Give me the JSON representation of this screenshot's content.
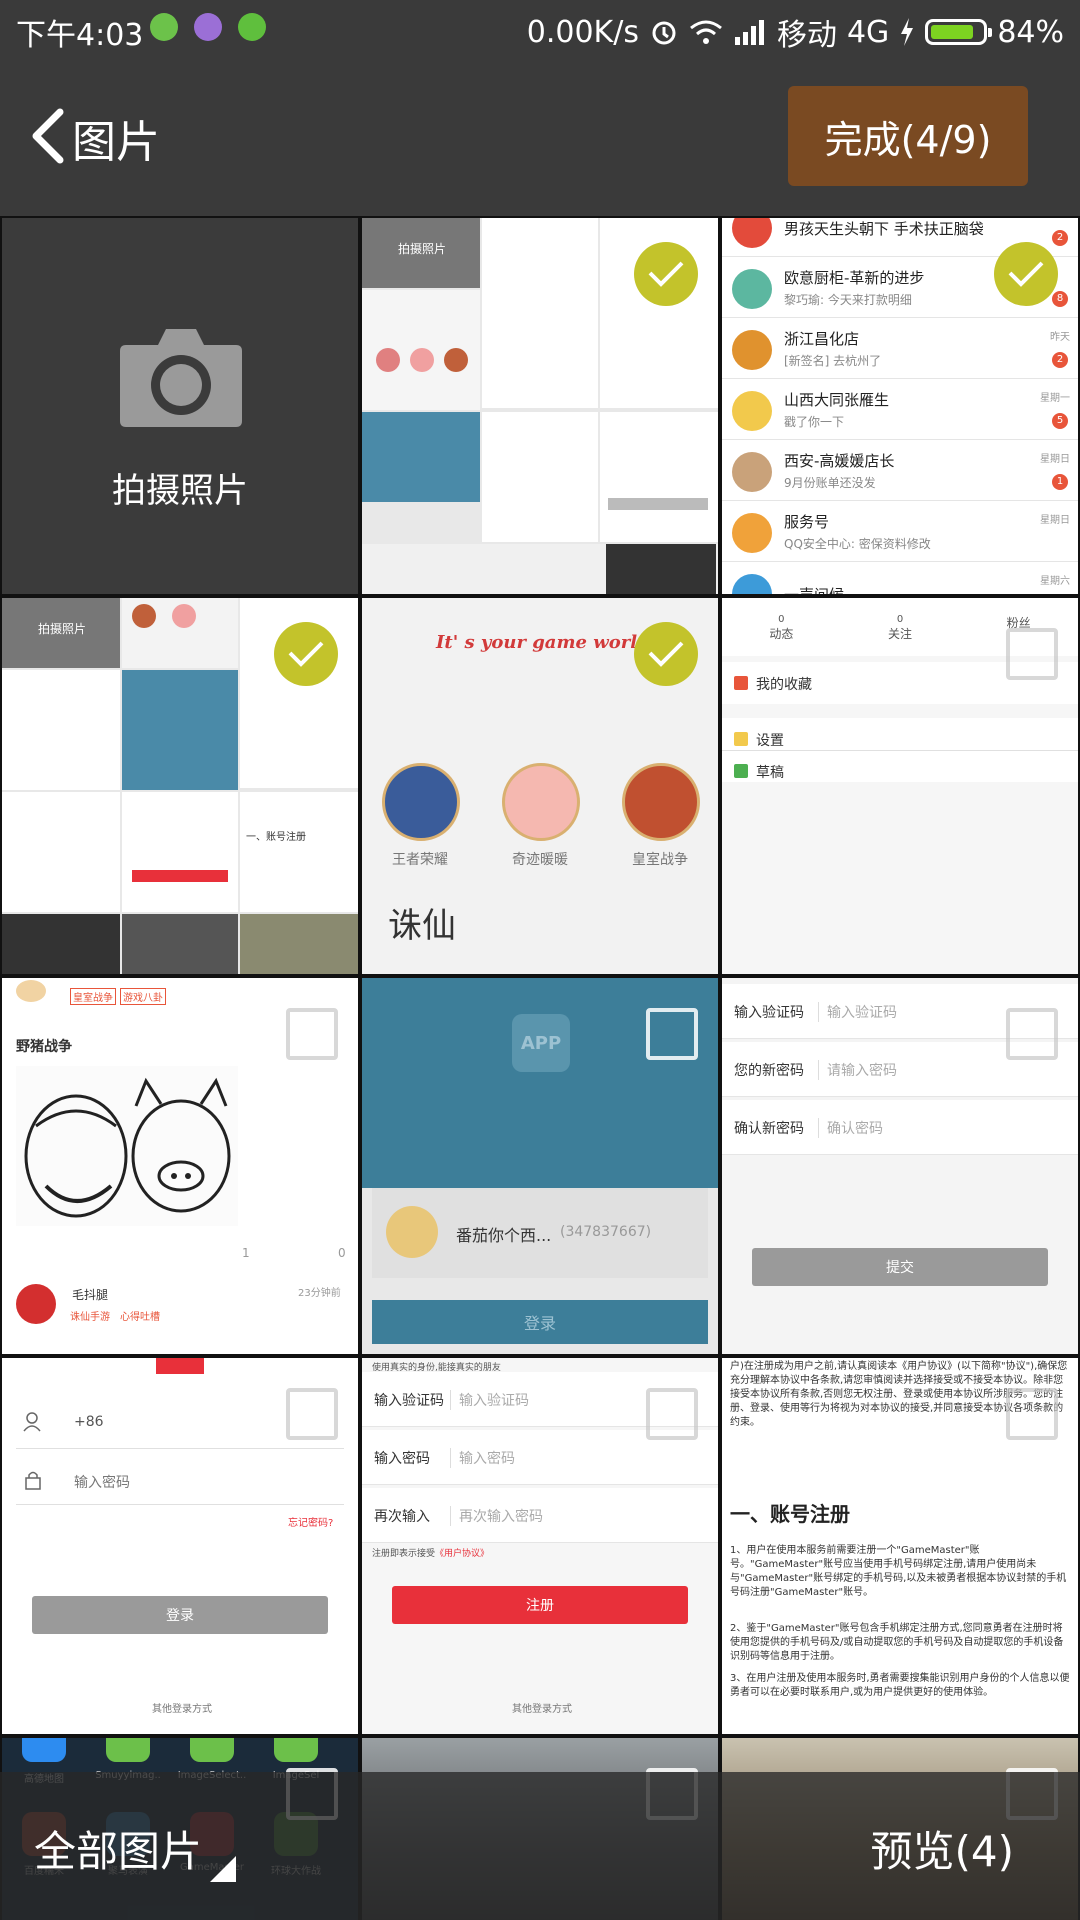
{
  "status_bar": {
    "time": "下午4:03",
    "net_speed": "0.00K/s",
    "carrier": "移动",
    "network": "4G",
    "battery": "84%",
    "battery_level": 0.84
  },
  "header": {
    "title": "图片",
    "done_label": "完成(4/9)"
  },
  "camera_tile": {
    "label": "拍摄照片"
  },
  "tiles": {
    "t1": {
      "caption": "拍摄照片"
    },
    "t2": {
      "rows": [
        {
          "name": "男孩天生头朝下 手术扶正脑袋",
          "time": "",
          "badge": "2"
        },
        {
          "name": "欧意厨柜-革新的进步",
          "sub": "黎巧瑜: 今天来打款明细",
          "time": "",
          "badge": "8"
        },
        {
          "name": "浙江昌化店",
          "sub": "[新签名] 去杭州了",
          "time": "昨天",
          "badge": "2"
        },
        {
          "name": "山西大同张雁生",
          "sub": "戳了你一下",
          "time": "星期一",
          "badge": "5"
        },
        {
          "name": "西安-高媛媛店长",
          "sub": "9月份账单还没发",
          "time": "星期日",
          "badge": "1"
        },
        {
          "name": "服务号",
          "sub": "QQ安全中心: 密保资料修改",
          "time": "星期日",
          "badge": ""
        },
        {
          "name": "一声问候",
          "sub": "",
          "time": "星期六",
          "badge": ""
        }
      ]
    },
    "t3": {
      "caption": "拍摄照片",
      "section": "一、账号注册"
    },
    "t4": {
      "slogan": "It' s your game world",
      "games": [
        "王者荣耀",
        "奇迹暖暖",
        "皇室战争"
      ],
      "logo_text": "诛仙"
    },
    "t5": {
      "stats": [
        {
          "num": "0",
          "label": "动态"
        },
        {
          "num": "0",
          "label": "关注"
        },
        {
          "num": "",
          "label": "粉丝"
        }
      ],
      "items": [
        "我的收藏",
        "设置",
        "草稿"
      ]
    },
    "t6": {
      "tags": [
        "皇室战争",
        "游戏八卦"
      ],
      "title": "野猪战争",
      "user": "毛抖腿",
      "time": "23分钟前",
      "tags2": [
        "诛仙手游",
        "心得吐槽"
      ],
      "likes": "1",
      "comments": "0"
    },
    "t7": {
      "app": "APP",
      "account": "番茄你个西...",
      "qq": "(347837667)",
      "login": "登录"
    },
    "t8": {
      "fields": [
        {
          "label": "输入验证码",
          "placeholder": "输入验证码"
        },
        {
          "label": "您的新密码",
          "placeholder": "请输入密码"
        },
        {
          "label": "确认新密码",
          "placeholder": "确认密码"
        }
      ],
      "submit": "提交"
    },
    "t9": {
      "phone": "+86",
      "password_ph": "输入密码",
      "forgot": "忘记密码?",
      "login": "登录",
      "other": "其他登录方式"
    },
    "t10": {
      "top_note": "使用真实的身份,能接真实的朋友",
      "fields": [
        {
          "label": "输入验证码",
          "placeholder": "输入验证码"
        },
        {
          "label": "输入密码",
          "placeholder": "输入密码"
        },
        {
          "label": "再次输入",
          "placeholder": "再次输入密码"
        }
      ],
      "agree": "注册即表示接受",
      "agree_link": "《用户协议》",
      "register": "注册",
      "other": "其他登录方式"
    },
    "t11": {
      "heading": "一、账号注册",
      "p1": "户)在注册成为用户之前,请认真阅读本《用户协议》(以下简称\"协议\"),确保您充分理解本协议中各条款,请您审慎阅读并选择接受或不接受本协议。除非您接受本协议所有条款,否则您无权注册、登录或使用本协议所涉服务。您的注册、登录、使用等行为将视为对本协议的接受,并同意接受本协议各项条款的约束。",
      "p2": "1、用户在使用本服务前需要注册一个\"GameMaster\"账号。\"GameMaster\"账号应当使用手机号码绑定注册,请用户使用尚未与\"GameMaster\"账号绑定的手机号码,以及未被勇者根据本协议封禁的手机号码注册\"GameMaster\"账号。",
      "p3": "2、鉴于\"GameMaster\"账号包含手机绑定注册方式,您同意勇者在注册时将使用您提供的手机号码及/或自动提取您的手机号码及自动提取您的手机设备识别码等信息用于注册。",
      "p4": "3、在用户注册及使用本服务时,勇者需要搜集能识别用户身份的个人信息以便勇者可以在必要时联系用户,或为用户提供更好的使用体验。"
    },
    "t12": {
      "apps": [
        "高德地图",
        "Smuyyimag..",
        "ImageSelect..",
        "ImageSel"
      ],
      "apps2": [
        "百度糯米",
        "聚马表演",
        "GameMaster",
        "环球大作战"
      ]
    }
  },
  "bottom_bar": {
    "all_photos": "全部图片",
    "preview": "预览(4)"
  },
  "colors": {
    "header_bg": "#3a3a3a",
    "done_bg": "#7a4a22",
    "check_bg": "#c3c32b",
    "register_red": "#e8303a"
  }
}
